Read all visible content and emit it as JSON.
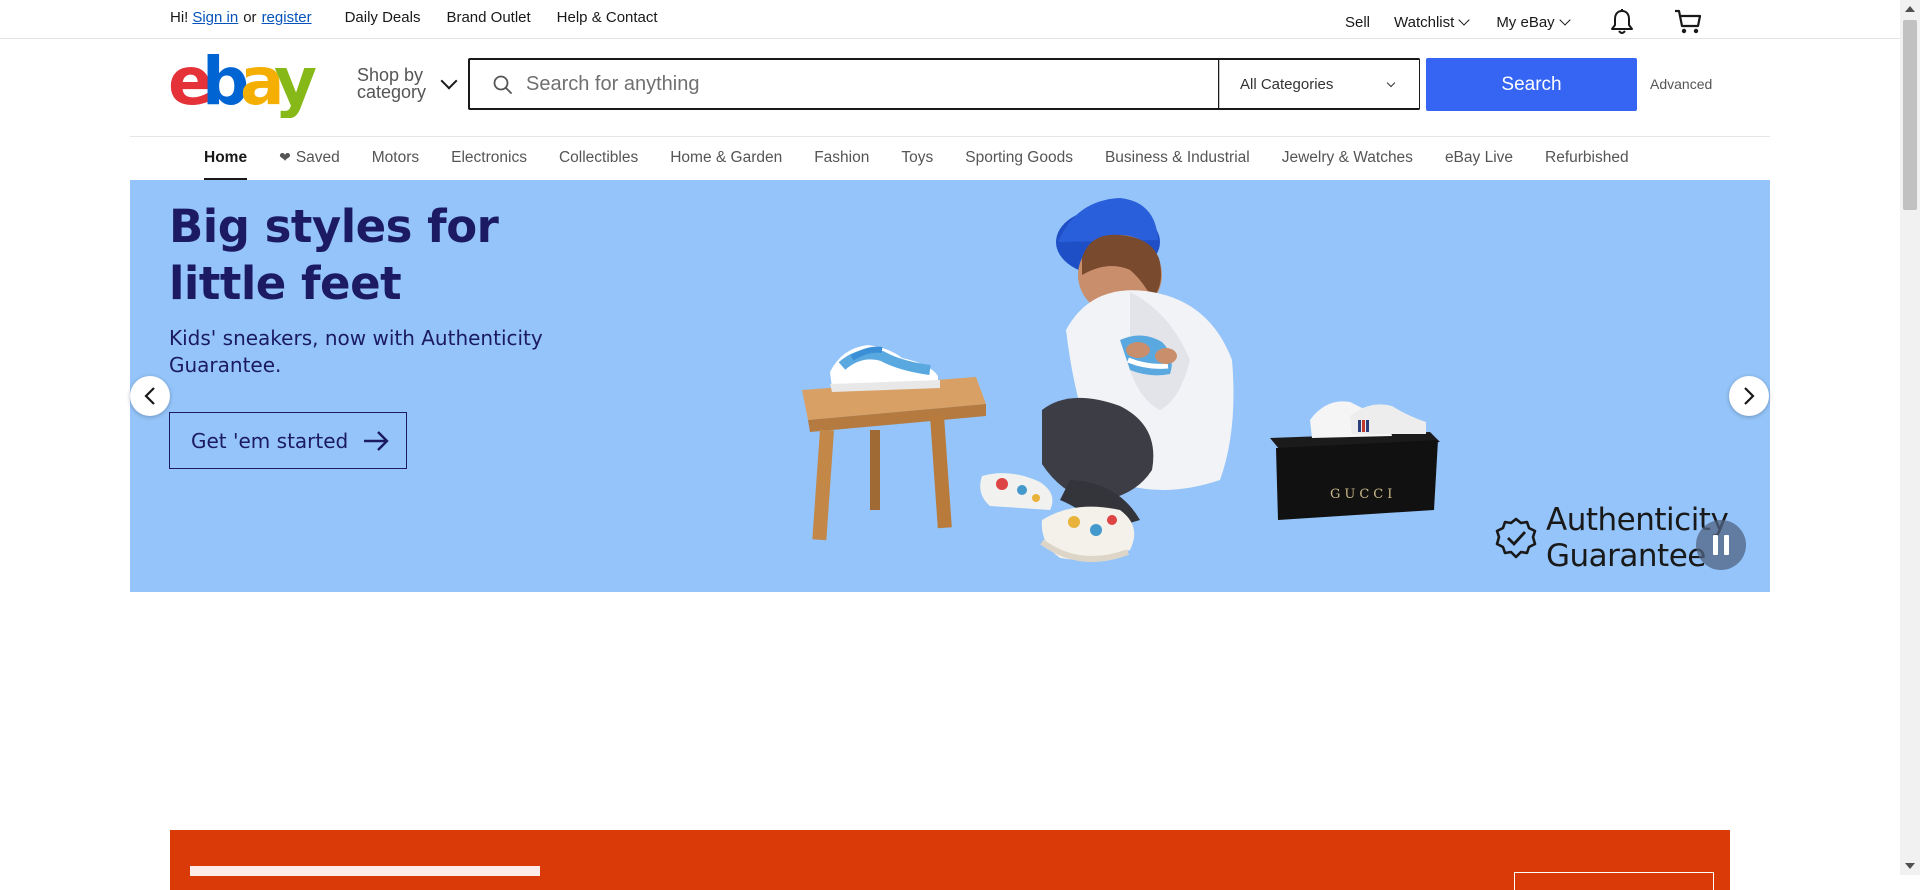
{
  "topbar": {
    "greeting": "Hi!",
    "sign_in": "Sign in",
    "or": "or",
    "register": "register",
    "daily_deals": "Daily Deals",
    "brand_outlet": "Brand Outlet",
    "help_contact": "Help & Contact",
    "sell": "Sell",
    "watchlist": "Watchlist",
    "my_ebay": "My eBay",
    "icons": [
      "bell-icon",
      "cart-icon"
    ]
  },
  "header": {
    "logo_letters": [
      "e",
      "b",
      "a",
      "y"
    ],
    "logo_colors": [
      "#e53238",
      "#0064d2",
      "#f5af02",
      "#86b817"
    ],
    "shop_by_category": "Shop by category",
    "search_placeholder": "Search for anything",
    "category_selected": "All Categories",
    "search_button": "Search",
    "advanced": "Advanced"
  },
  "nav": {
    "items": [
      {
        "label": "Home",
        "active": true
      },
      {
        "label": "Saved",
        "icon": "heart-icon"
      },
      {
        "label": "Motors"
      },
      {
        "label": "Electronics"
      },
      {
        "label": "Collectibles"
      },
      {
        "label": "Home & Garden"
      },
      {
        "label": "Fashion"
      },
      {
        "label": "Toys"
      },
      {
        "label": "Sporting Goods"
      },
      {
        "label": "Business & Industrial"
      },
      {
        "label": "Jewelry & Watches"
      },
      {
        "label": "eBay Live"
      },
      {
        "label": "Refurbished"
      }
    ]
  },
  "hero": {
    "title": "Big styles for little feet",
    "subtitle": "Kids' sneakers, now with Authenticity Guarantee.",
    "cta": "Get 'em started",
    "badge_line1": "Authenticity",
    "badge_line2": "Guarantee",
    "box_label": "GUCCI",
    "background": "#94c4f9",
    "text_color": "#1b1a63"
  },
  "colors": {
    "accent": "#3665f3",
    "link": "#0654ba",
    "promo": "#d93a07"
  }
}
